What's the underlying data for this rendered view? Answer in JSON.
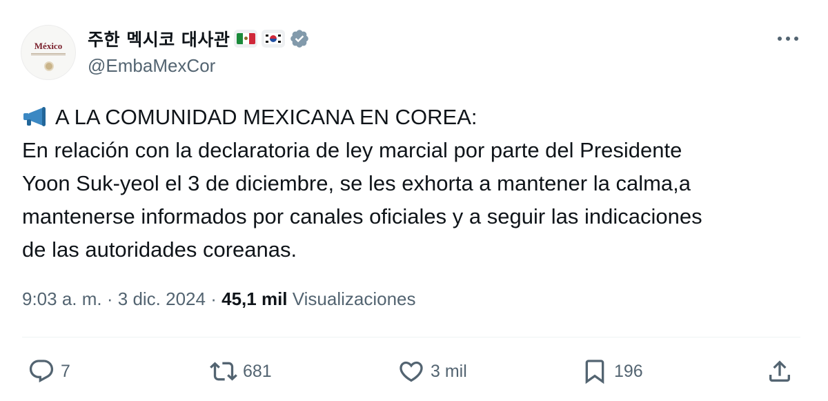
{
  "account": {
    "display_name": "주한 멕시코 대사관",
    "handle": "@EmbaMexCor",
    "avatar_text": "México",
    "flags": [
      "mexico-flag",
      "south-korea-flag"
    ],
    "verified": true
  },
  "tweet": {
    "lines": [
      "A LA COMUNIDAD MEXICANA EN COREA:",
      "En relación con la declaratoria de ley marcial por parte del Presidente",
      "Yoon Suk-yeol el 3 de diciembre, se les exhorta a mantener la calma,a",
      "mantenerse informados por canales oficiales y a seguir las indicaciones",
      "de las autoridades coreanas."
    ],
    "lead_icon": "megaphone-icon"
  },
  "meta": {
    "time": "9:03 a. m.",
    "separator": "·",
    "date": "3 dic. 2024",
    "views_count": "45,1 mil",
    "views_label": "Visualizaciones"
  },
  "actions": {
    "replies": "7",
    "reposts": "681",
    "likes": "3 mil",
    "bookmarks": "196"
  },
  "colors": {
    "text": "#0f1419",
    "secondary": "#536471",
    "verified": "#829aab",
    "megaphone": "#3b88c3"
  }
}
